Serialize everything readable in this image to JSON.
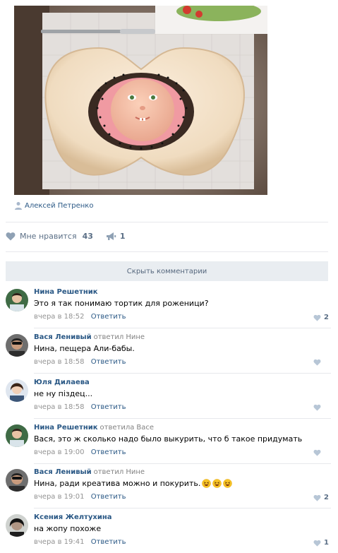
{
  "post": {
    "author": "Алексей Петренко",
    "likes_label": "Мне нравится",
    "likes_count": "43",
    "shares_count": "1"
  },
  "comments_toggle": "Скрыть комментарии",
  "colors": {
    "link": "#2a5885",
    "meta": "#939393",
    "toggle_bg": "#e9edf1",
    "divider": "#e7e8ec"
  },
  "comments": [
    {
      "author": "Нина Решетник",
      "reply_word": "",
      "reply_to": "",
      "text": "Это я так понимаю тортик для роженици?",
      "emoji": 0,
      "date": "вчера в 18:52",
      "reply_label": "Ответить",
      "likes": "2"
    },
    {
      "author": "Вася Ленивый",
      "reply_word": "ответил",
      "reply_to": "Нине",
      "text": "Нина, пещера Али-бабы.",
      "emoji": 0,
      "date": "вчера в 18:58",
      "reply_label": "Ответить",
      "likes": ""
    },
    {
      "author": "Юля Дилаева",
      "reply_word": "",
      "reply_to": "",
      "text": "не ну піздец...",
      "emoji": 0,
      "date": "вчера в 18:58",
      "reply_label": "Ответить",
      "likes": ""
    },
    {
      "author": "Нина Решетник",
      "reply_word": "ответила",
      "reply_to": "Васе",
      "text": "Вася, это ж сколько надо было выкурить, что б такое придумать",
      "emoji": 0,
      "date": "вчера в 19:00",
      "reply_label": "Ответить",
      "likes": ""
    },
    {
      "author": "Вася Ленивый",
      "reply_word": "ответил",
      "reply_to": "Нине",
      "text": "Нина, ради креатива можно и покурить.",
      "emoji": 3,
      "date": "вчера в 19:01",
      "reply_label": "Ответить",
      "likes": "2"
    },
    {
      "author": "Ксения Желтухина",
      "reply_word": "",
      "reply_to": "",
      "text": "на жопу похоже",
      "emoji": 0,
      "date": "вчера в 19:41",
      "reply_label": "Ответить",
      "likes": "1"
    }
  ]
}
